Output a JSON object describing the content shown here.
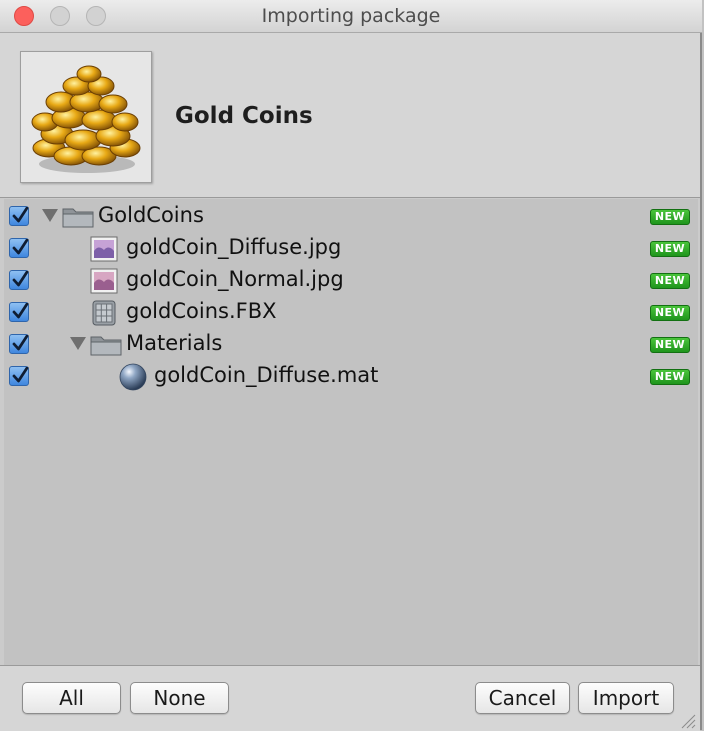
{
  "window": {
    "title": "Importing package"
  },
  "package": {
    "name": "Gold Coins"
  },
  "tree": {
    "items": [
      {
        "label": "GoldCoins",
        "type": "folder",
        "checked": true,
        "badge": "NEW"
      },
      {
        "label": "goldCoin_Diffuse.jpg",
        "type": "image",
        "checked": true,
        "badge": "NEW"
      },
      {
        "label": "goldCoin_Normal.jpg",
        "type": "image",
        "checked": true,
        "badge": "NEW"
      },
      {
        "label": "goldCoins.FBX",
        "type": "mesh",
        "checked": true,
        "badge": "NEW"
      },
      {
        "label": "Materials",
        "type": "folder",
        "checked": true,
        "badge": "NEW"
      },
      {
        "label": "goldCoin_Diffuse.mat",
        "type": "material",
        "checked": true,
        "badge": "NEW"
      }
    ]
  },
  "footer": {
    "all_label": "All",
    "none_label": "None",
    "cancel_label": "Cancel",
    "import_label": "Import"
  },
  "colors": {
    "badge": "#2aa526",
    "checkbox": "#3f86de",
    "close": "#fc605c"
  }
}
